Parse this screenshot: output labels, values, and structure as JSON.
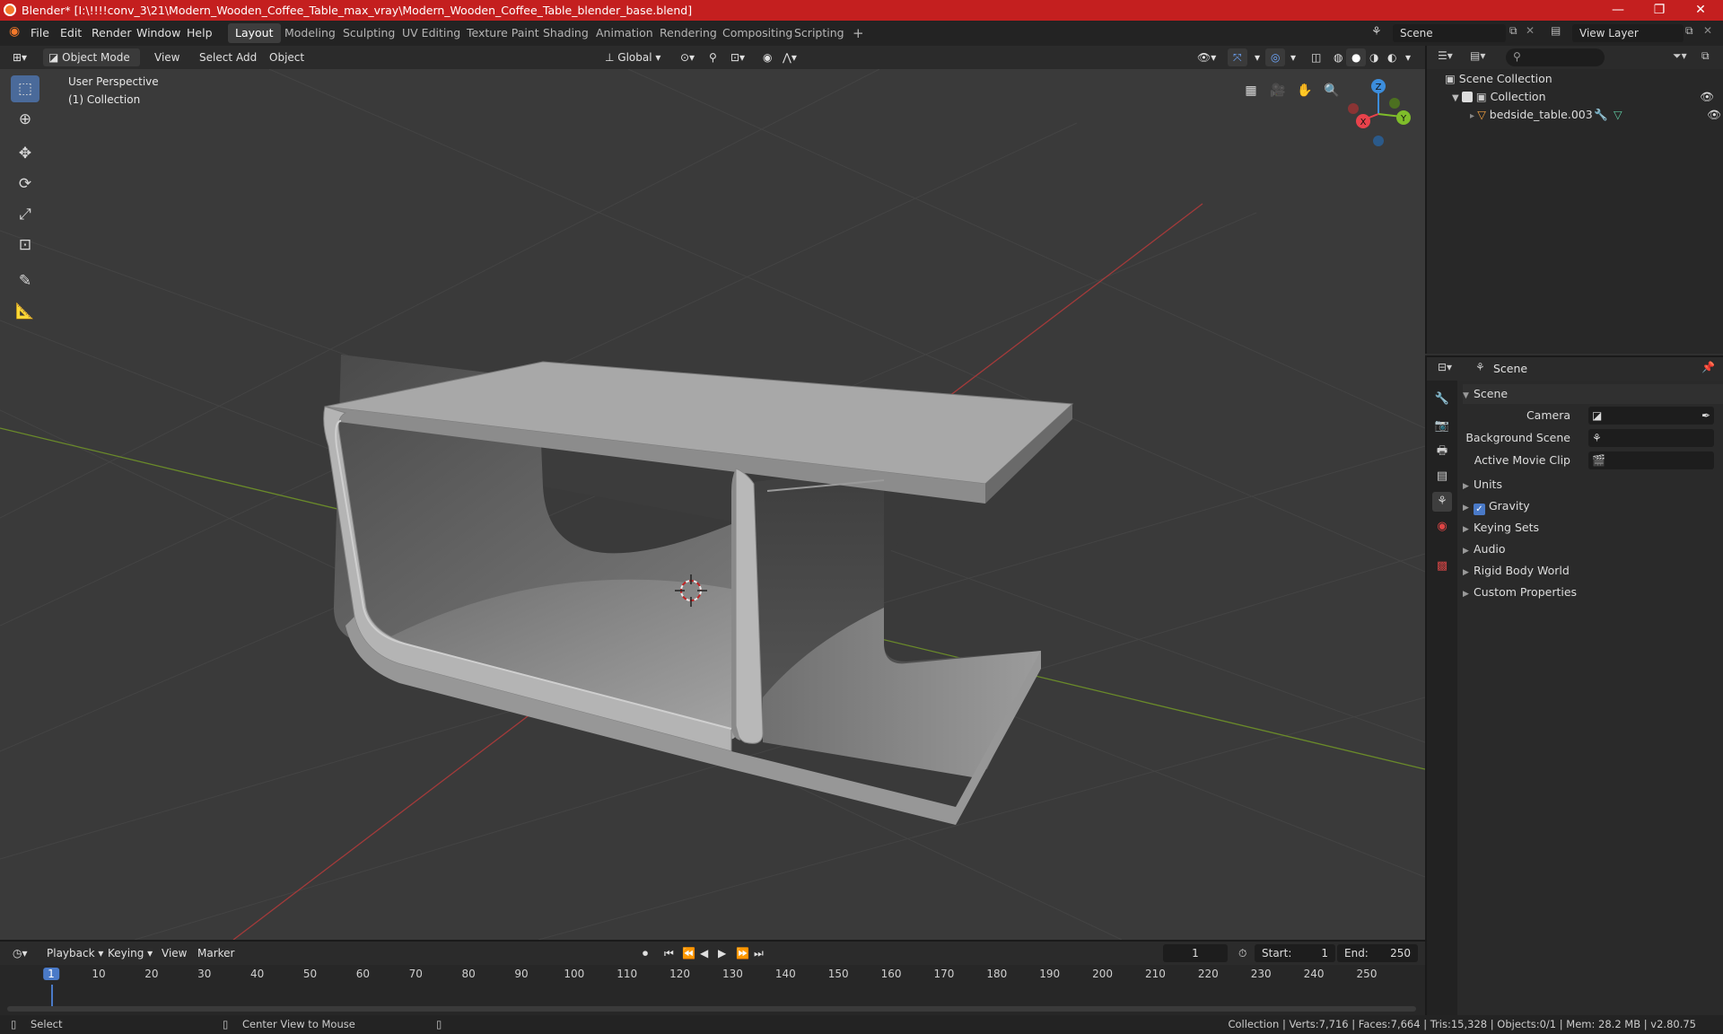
{
  "window": {
    "title": "Blender* [I:\\!!!!conv_3\\21\\Modern_Wooden_Coffee_Table_max_vray\\Modern_Wooden_Coffee_Table_blender_base.blend]",
    "minimize": "—",
    "maximize": "❐",
    "close": "✕"
  },
  "menu": [
    "File",
    "Edit",
    "Render",
    "Window",
    "Help"
  ],
  "workspaces": [
    "Layout",
    "Modeling",
    "Sculpting",
    "UV Editing",
    "Texture Paint",
    "Shading",
    "Animation",
    "Rendering",
    "Compositing",
    "Scripting"
  ],
  "workspace_add": "+",
  "scene_field": "Scene",
  "view_layer_field": "View Layer",
  "header3d": {
    "mode": "Object Mode",
    "menus": [
      "View",
      "Select",
      "Add",
      "Object"
    ],
    "transform_orientation": "Global"
  },
  "viewport": {
    "perspective_label": "User Perspective",
    "collection_label": "(1) Collection",
    "gizmo": {
      "x": "X",
      "y": "Y",
      "z": "Z"
    }
  },
  "outliner": {
    "search_placeholder": "",
    "items": [
      {
        "label": "Scene Collection"
      },
      {
        "label": "Collection"
      },
      {
        "label": "bedside_table.003"
      }
    ]
  },
  "properties": {
    "breadcrumb": "Scene",
    "panel_title": "Scene",
    "fields": [
      {
        "label": "Camera",
        "value": ""
      },
      {
        "label": "Background Scene",
        "value": ""
      },
      {
        "label": "Active Movie Clip",
        "value": ""
      }
    ],
    "sections": [
      {
        "label": "Units",
        "checkbox": false
      },
      {
        "label": "Gravity",
        "checkbox": true
      },
      {
        "label": "Keying Sets",
        "checkbox": false
      },
      {
        "label": "Audio",
        "checkbox": false
      },
      {
        "label": "Rigid Body World",
        "checkbox": false
      },
      {
        "label": "Custom Properties",
        "checkbox": false
      }
    ]
  },
  "timeline": {
    "menus": [
      "Playback",
      "Keying",
      "View",
      "Marker"
    ],
    "current_frame": "1",
    "start_label": "Start:",
    "start_value": "1",
    "end_label": "End:",
    "end_value": "250",
    "ruler": [
      "1",
      "10",
      "20",
      "30",
      "40",
      "50",
      "60",
      "70",
      "80",
      "90",
      "100",
      "110",
      "120",
      "130",
      "140",
      "150",
      "160",
      "170",
      "180",
      "190",
      "200",
      "210",
      "220",
      "230",
      "240",
      "250"
    ]
  },
  "status": {
    "left": "Select",
    "middle": "Center View to Mouse",
    "right": "Collection | Verts:7,716 | Faces:7,664 | Tris:15,328 | Objects:0/1 | Mem: 28.2 MB | v2.80.75"
  },
  "colors": {
    "titlebar": "#c41f1f",
    "accent": "#4a7ac8",
    "gizmo_x": "#e8424b",
    "gizmo_y": "#7fbd2a",
    "gizmo_z": "#3c8ddc"
  }
}
